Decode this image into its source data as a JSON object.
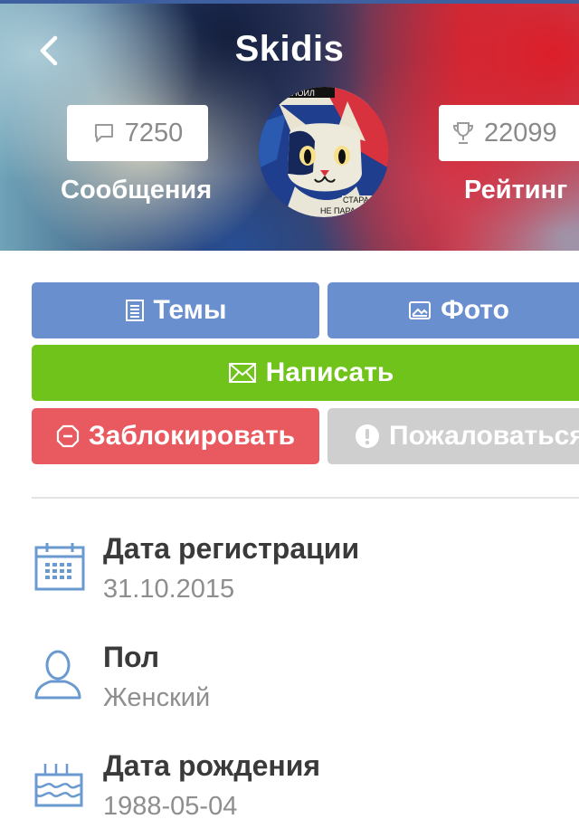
{
  "header": {
    "title": "Skidis",
    "messages": {
      "count": "7250",
      "label": "Сообщения"
    },
    "rating": {
      "count": "22099",
      "label": "Рейтинг"
    },
    "avatar_text_top": "АНОИЛ",
    "avatar_text_bottom1": "СТАРА",
    "avatar_text_bottom2": "НЕ ПАРА"
  },
  "actions": {
    "topics": "Темы",
    "photo": "Фото",
    "write": "Написать",
    "block": "Заблокировать",
    "report": "Пожаловаться"
  },
  "info": {
    "registration": {
      "title": "Дата регистрации",
      "value": "31.10.2015"
    },
    "gender": {
      "title": "Пол",
      "value": "Женский"
    },
    "birthday": {
      "title": "Дата рождения",
      "value": "1988-05-04"
    }
  },
  "colors": {
    "accent_blue": "#6a8fce",
    "write_green": "#70c31a",
    "block_red": "#e85a5f",
    "report_gray": "#cfcfcf",
    "icon_blue": "#6a9ad0"
  }
}
